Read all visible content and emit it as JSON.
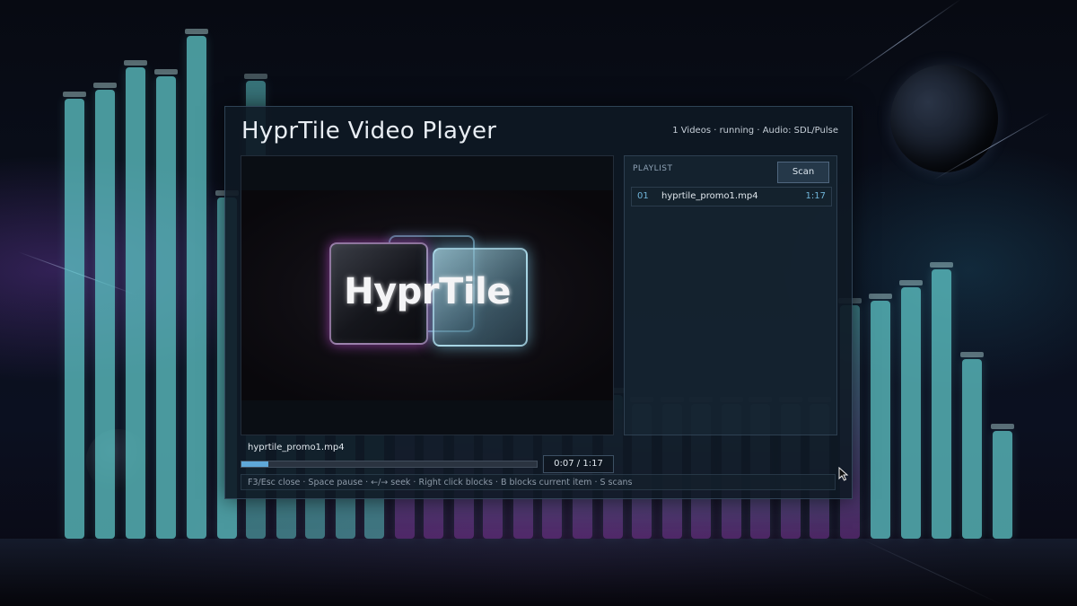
{
  "window": {
    "title": "HyprTile Video Player",
    "status": "1 Videos · running · Audio: SDL/Pulse"
  },
  "video": {
    "logo_text": "HyprTile"
  },
  "playlist": {
    "label": "PLAYLIST",
    "scan_label": "Scan",
    "items": [
      {
        "index": "01",
        "name": "hyprtile_promo1.mp4",
        "duration": "1:17"
      }
    ]
  },
  "player": {
    "now_playing": "hyprtile_promo1.mp4",
    "time_display": "0:07 / 1:17",
    "progress_fraction": 0.09
  },
  "help": {
    "text": "F3/Esc close · Space pause · ←/→ seek · Right click blocks · B blocks current item · S scans"
  },
  "colors": {
    "accent": "#5fa8d8",
    "bar_top": "#5fc7c9",
    "bar_bottom": "#7a3a9a"
  },
  "icons": {
    "cursor": "mouse-pointer-icon"
  }
}
